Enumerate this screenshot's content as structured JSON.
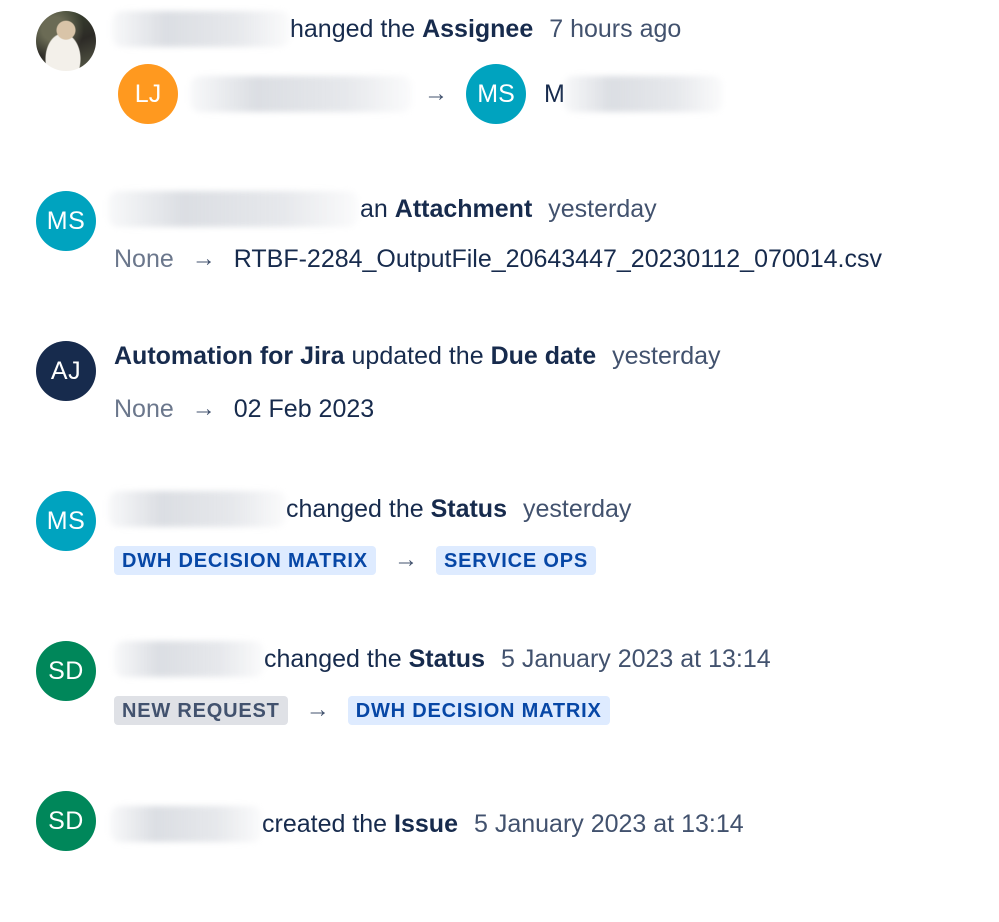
{
  "colors": {
    "avatar_lj": "#ff991f",
    "avatar_ms": "#00a3bf",
    "avatar_aj": "#172b4d",
    "avatar_sd": "#00875a",
    "lozenge_blue_bg": "#deebff",
    "lozenge_blue_text": "#0747a6",
    "lozenge_grey_bg": "#dfe1e6",
    "lozenge_grey_text": "#42526e"
  },
  "history": [
    {
      "avatar_initials": "",
      "action_text": "hanged the",
      "field": "Assignee",
      "time": "7 hours ago",
      "from_avatar": "LJ",
      "to_avatar": "MS",
      "to_name_partial": "M",
      "arrow": "→"
    },
    {
      "avatar_initials": "MS",
      "action_text": "an",
      "field": "Attachment",
      "time": "yesterday",
      "from_value": "None",
      "to_value": "RTBF-2284_OutputFile_20643447_20230112_070014.csv",
      "arrow": "→"
    },
    {
      "avatar_initials": "AJ",
      "actor": "Automation for Jira",
      "action_text": "updated the",
      "field": "Due date",
      "time": "yesterday",
      "from_value": "None",
      "to_value": "02 Feb 2023",
      "arrow": "→"
    },
    {
      "avatar_initials": "MS",
      "action_text": "changed the",
      "field": "Status",
      "time": "yesterday",
      "from_status": "DWH DECISION MATRIX",
      "to_status": "SERVICE OPS",
      "arrow": "→"
    },
    {
      "avatar_initials": "SD",
      "action_text": "changed the",
      "field": "Status",
      "time": "5 January 2023 at 13:14",
      "from_status": "NEW REQUEST",
      "to_status": "DWH DECISION MATRIX",
      "arrow": "→"
    },
    {
      "avatar_initials": "SD",
      "action_text": "created the",
      "field": "Issue",
      "time": "5 January 2023 at 13:14"
    }
  ]
}
